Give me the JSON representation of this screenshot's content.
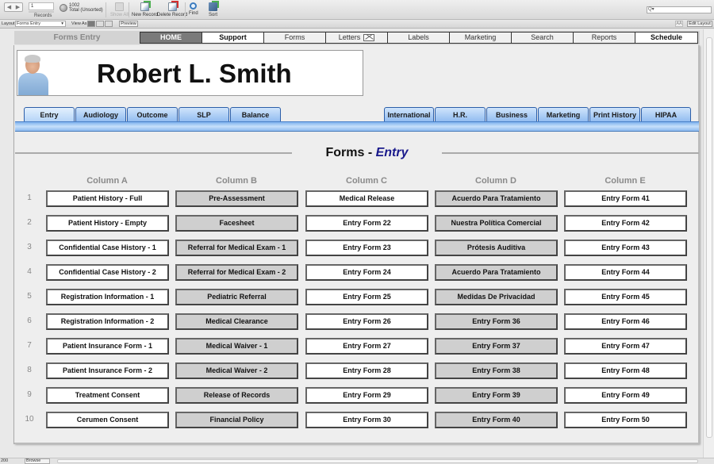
{
  "toolbar": {
    "record_current": "1",
    "records_label": "Records",
    "total_count": "1002",
    "total_label": "Total (Unsorted)",
    "buttons": [
      {
        "label": "Show All",
        "icon": "show-all-icon",
        "enabled": false
      },
      {
        "label": "New Record",
        "icon": "new-record-icon",
        "enabled": true
      },
      {
        "label": "Delete Record",
        "icon": "delete-record-icon",
        "enabled": true
      },
      {
        "label": "Find",
        "icon": "find-icon",
        "enabled": true
      },
      {
        "label": "Sort",
        "icon": "sort-icon",
        "enabled": true
      }
    ],
    "quick_find_glyph": "Q▾",
    "quick_find_value": ""
  },
  "layout_bar": {
    "layout_label": "Layout:",
    "layout_value": "Forms Entry",
    "view_as_label": "View As:",
    "preview_label": "Preview",
    "aa_label": "AÂ",
    "edit_layout_label": "Edit Layout"
  },
  "topnav": {
    "app_title": "Forms Entry",
    "tabs": [
      "HOME",
      "Support",
      "Forms",
      "Letters",
      "Labels",
      "Marketing",
      "Search",
      "Reports",
      "Schedule"
    ]
  },
  "patient": {
    "name": "Robert L. Smith"
  },
  "module_tabs": {
    "left": [
      "Entry",
      "Audiology",
      "Outcome",
      "SLP",
      "Balance"
    ],
    "right": [
      "International",
      "H.R.",
      "Business",
      "Marketing",
      "Print History",
      "HIPAA"
    ],
    "active": "Entry"
  },
  "section": {
    "prefix": "Forms - ",
    "accent": "Entry",
    "accent_color": "#1a1a8c"
  },
  "grid": {
    "columns": [
      "Column A",
      "Column B",
      "Column C",
      "Column D",
      "Column E"
    ],
    "row_numbers": [
      "1",
      "2",
      "3",
      "4",
      "5",
      "6",
      "7",
      "8",
      "9",
      "10"
    ],
    "rows": [
      [
        "Patient History - Full",
        "Pre-Assessment",
        "Medical Release",
        "Acuerdo Para Tratamiento",
        "Entry Form 41"
      ],
      [
        "Patient History - Empty",
        "Facesheet",
        "Entry Form 22",
        "Nuestra Política Comercial",
        "Entry Form 42"
      ],
      [
        "Confidential Case History - 1",
        "Referral for Medical Exam - 1",
        "Entry Form 23",
        "Prótesis Auditiva",
        "Entry Form 43"
      ],
      [
        "Confidential Case History - 2",
        "Referral for Medical Exam - 2",
        "Entry Form 24",
        "Acuerdo Para Tratamiento",
        "Entry Form 44"
      ],
      [
        "Registration Information - 1",
        "Pediatric Referral",
        "Entry Form 25",
        "Medidas De Privacidad",
        "Entry Form 45"
      ],
      [
        "Registration Information - 2",
        "Medical Clearance",
        "Entry Form 26",
        "Entry Form 36",
        "Entry Form 46"
      ],
      [
        "Patient Insurance Form - 1",
        "Medical Waiver - 1",
        "Entry Form 27",
        "Entry Form 37",
        "Entry Form 47"
      ],
      [
        "Patient Insurance Form - 2",
        "Medical Waiver - 2",
        "Entry Form 28",
        "Entry Form 38",
        "Entry Form 48"
      ],
      [
        "Treatment Consent",
        "Release of Records",
        "Entry Form 29",
        "Entry Form 39",
        "Entry Form 49"
      ],
      [
        "Cerumen Consent",
        "Financial Policy",
        "Entry Form 30",
        "Entry Form 40",
        "Entry Form 50"
      ]
    ]
  },
  "statusbar": {
    "zoom_level": "200",
    "mode": "Browse"
  }
}
